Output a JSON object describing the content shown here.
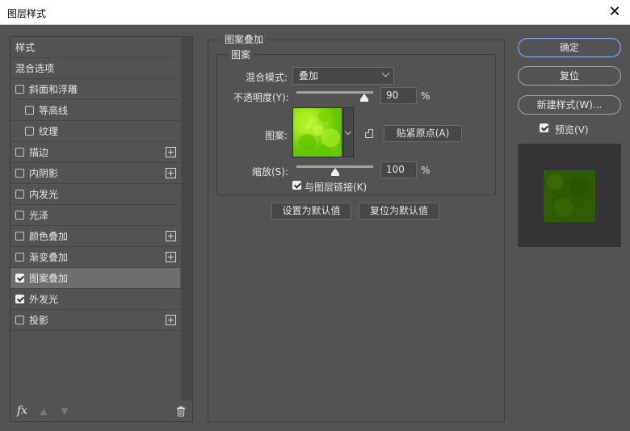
{
  "window": {
    "title": "图层样式",
    "close_glyph": "✕"
  },
  "sidebar": {
    "items": [
      {
        "label": "样式",
        "checkbox": false
      },
      {
        "label": "混合选项",
        "checkbox": false
      },
      {
        "label": "斜面和浮雕",
        "checkbox": true,
        "checked": false
      },
      {
        "label": "等高线",
        "checkbox": true,
        "checked": false,
        "indent": true
      },
      {
        "label": "纹理",
        "checkbox": true,
        "checked": false,
        "indent": true
      },
      {
        "label": "描边",
        "checkbox": true,
        "checked": false,
        "plus": true
      },
      {
        "label": "内阴影",
        "checkbox": true,
        "checked": false,
        "plus": true
      },
      {
        "label": "内发光",
        "checkbox": true,
        "checked": false
      },
      {
        "label": "光泽",
        "checkbox": true,
        "checked": false
      },
      {
        "label": "颜色叠加",
        "checkbox": true,
        "checked": false,
        "plus": true
      },
      {
        "label": "渐变叠加",
        "checkbox": true,
        "checked": false,
        "plus": true
      },
      {
        "label": "图案叠加",
        "checkbox": true,
        "checked": true,
        "selected": true
      },
      {
        "label": "外发光",
        "checkbox": true,
        "checked": true
      },
      {
        "label": "投影",
        "checkbox": true,
        "checked": false,
        "plus": true
      }
    ],
    "footer": {
      "fx_label": "fx"
    }
  },
  "panel": {
    "group_title": "图案叠加",
    "inner_title": "图案",
    "blend_mode_label": "混合模式:",
    "blend_mode_value": "叠加",
    "opacity_label": "不透明度(Y):",
    "opacity_value": "90",
    "opacity_unit": "%",
    "pattern_label": "图案:",
    "snap_origin_button": "贴紧原点(A)",
    "scale_label": "缩放(S):",
    "scale_value": "100",
    "scale_unit": "%",
    "link_layer_label": "与图层链接(K)",
    "link_layer_checked": true,
    "set_default_button": "设置为默认值",
    "reset_default_button": "复位为默认值"
  },
  "buttons": {
    "ok": "确定",
    "reset": "复位",
    "new_style": "新建样式(W)...",
    "preview_label": "预览(V)",
    "preview_checked": true
  }
}
